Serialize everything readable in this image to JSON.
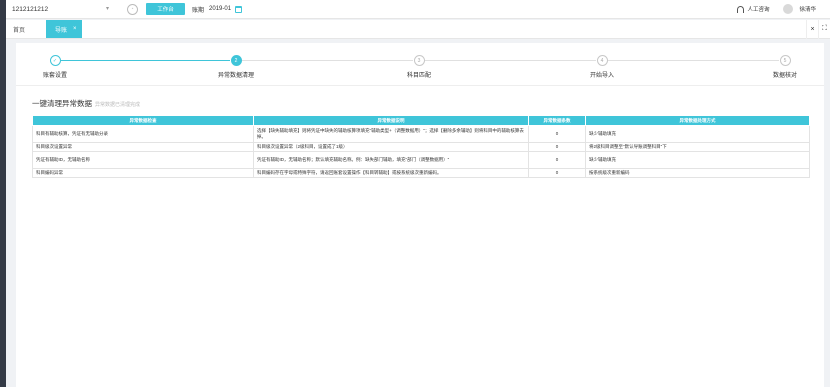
{
  "topbar": {
    "company": "1212121212",
    "workbench_label": "工作台",
    "period_label": "账期",
    "period_value": "2019-01",
    "service_label": "人工咨询",
    "user_name": "徐清华"
  },
  "tabs": {
    "home": "首页",
    "active": "导账",
    "active_close": "×"
  },
  "tools": {
    "close": "×",
    "fullscreen": "⛶"
  },
  "steps": [
    {
      "label": "账套设置",
      "status": "done",
      "marker": "✓"
    },
    {
      "label": "异常数据清理",
      "status": "current",
      "marker": "2"
    },
    {
      "label": "科目匹配",
      "status": "todo",
      "marker": "3"
    },
    {
      "label": "开始导入",
      "status": "todo",
      "marker": "4"
    },
    {
      "label": "数据核对",
      "status": "todo",
      "marker": "5"
    }
  ],
  "section": {
    "title": "一键清理异常数据",
    "subtitle": "异常数据已清理完成"
  },
  "table": {
    "headers": [
      "异常数据检查",
      "异常数据说明",
      "异常数据条数",
      "异常数据处理方式"
    ],
    "rows": [
      {
        "check": "科目有辅助核算，凭证有无辅助分录",
        "desc": "选择【缺失辅助填充】则将凭证中缺失的辅助核算项填充\"辅助类型+（调整数据用）\"；选择【删除多余辅助】则将科目中的辅助核算去掉。",
        "count": "0",
        "method": "缺少辅助填充"
      },
      {
        "check": "科目级次设置异常",
        "desc": "科目级次设置异常（2级科目，设置成了1级）",
        "count": "0",
        "method": "将2级科目调整至\"默认导账调整科目\"下"
      },
      {
        "check": "凭证有辅助ID，无辅助名称",
        "desc": "凭证有辅助ID，无辅助名称；默认填充辅助名称。例：缺失部门辅助，填充\"部门（调整数据用）\"",
        "count": "0",
        "method": "缺少辅助填充"
      },
      {
        "check": "科目编码异常",
        "desc": "科目编码存在字母或特殊字符，请返回账套设置操作【科目转辅助】或按系统级次重新编码。",
        "count": "0",
        "method": "按系统级次重新编码"
      }
    ]
  },
  "colors": {
    "accent": "#3fc5d9",
    "sidebar": "#343a46"
  },
  "icons": {
    "company_dropdown": "chevron-down-icon",
    "circle": "circle-icon",
    "calendar": "calendar-icon",
    "service": "headset-icon",
    "user": "avatar",
    "close": "close-icon",
    "fullscreen": "fullscreen-icon"
  }
}
